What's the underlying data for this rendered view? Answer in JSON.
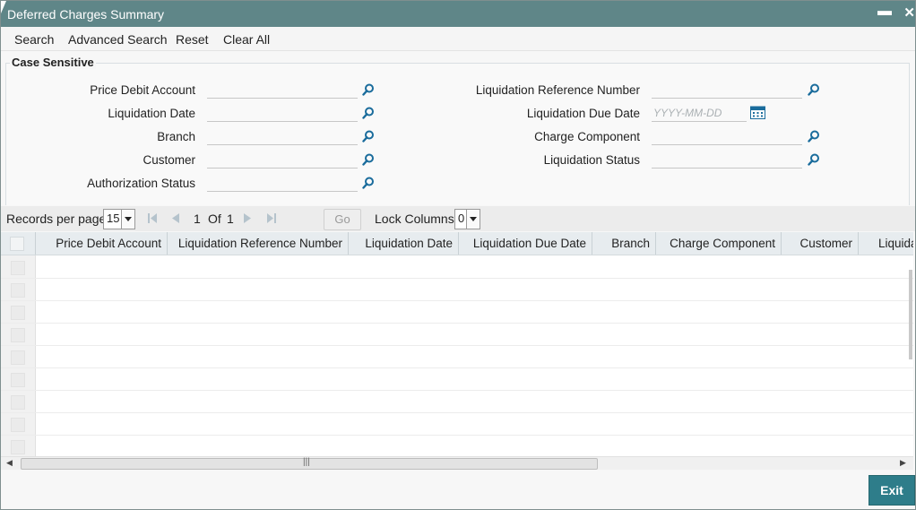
{
  "window": {
    "title": "Deferred Charges Summary",
    "minimize_glyph": "▬",
    "close_glyph": "✕"
  },
  "menu": {
    "search": "Search",
    "advanced_search": "Advanced Search",
    "reset": "Reset",
    "clear_all": "Clear All"
  },
  "criteria": {
    "legend": "Case Sensitive",
    "price_debit_account": {
      "label": "Price Debit Account",
      "value": ""
    },
    "liquidation_date": {
      "label": "Liquidation Date",
      "value": ""
    },
    "branch": {
      "label": "Branch",
      "value": ""
    },
    "customer": {
      "label": "Customer",
      "value": ""
    },
    "authorization_status": {
      "label": "Authorization Status",
      "value": ""
    },
    "liquidation_reference_number": {
      "label": "Liquidation Reference Number",
      "value": ""
    },
    "liquidation_due_date": {
      "label": "Liquidation Due Date",
      "value": "",
      "placeholder": "YYYY-MM-DD"
    },
    "charge_component": {
      "label": "Charge Component",
      "value": ""
    },
    "liquidation_status": {
      "label": "Liquidation Status",
      "value": ""
    }
  },
  "pager": {
    "records_per_page_label": "Records per page",
    "records_per_page": "15",
    "current_page": "1",
    "of_label": "Of",
    "total_pages": "1",
    "go_label": "Go",
    "lock_columns_label": "Lock Columns",
    "lock_columns": "0"
  },
  "grid": {
    "columns": [
      "Price Debit Account",
      "Liquidation Reference Number",
      "Liquidation Date",
      "Liquidation Due Date",
      "Branch",
      "Charge Component",
      "Customer",
      "Liquida"
    ],
    "rows": []
  },
  "footer": {
    "exit_label": "Exit"
  },
  "colors": {
    "titlebar": "#5f8688",
    "accent": "#2e7d8a",
    "search_icon": "#1a6c9c"
  }
}
